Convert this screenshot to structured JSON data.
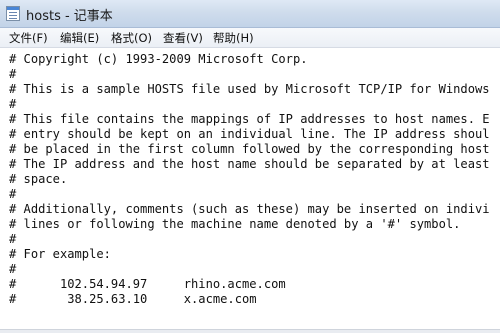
{
  "window": {
    "title": "hosts - 记事本",
    "icon": "notepad-icon"
  },
  "menu": [
    {
      "label": "文件(F)"
    },
    {
      "label": "编辑(E)"
    },
    {
      "label": "格式(O)"
    },
    {
      "label": "查看(V)"
    },
    {
      "label": "帮助(H)"
    }
  ],
  "document": {
    "lines": [
      "# Copyright (c) 1993-2009 Microsoft Corp.",
      "#",
      "# This is a sample HOSTS file used by Microsoft TCP/IP for Windows",
      "#",
      "# This file contains the mappings of IP addresses to host names. E",
      "# entry should be kept on an individual line. The IP address shoul",
      "# be placed in the first column followed by the corresponding host",
      "# The IP address and the host name should be separated by at least",
      "# space.",
      "#",
      "# Additionally, comments (such as these) may be inserted on indivi",
      "# lines or following the machine name denoted by a '#' symbol.",
      "#",
      "# For example:",
      "#",
      "#      102.54.94.97     rhino.acme.com",
      "#       38.25.63.10     x.acme.com"
    ]
  }
}
